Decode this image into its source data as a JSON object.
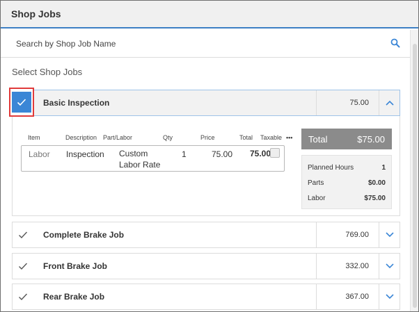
{
  "window": {
    "title": "Shop Jobs"
  },
  "search": {
    "placeholder": "Search by Shop Job Name"
  },
  "section_label": "Select Shop Jobs",
  "jobs": [
    {
      "name": "Basic Inspection",
      "price": "75.00",
      "selected": true,
      "expanded": true
    },
    {
      "name": "Complete Brake Job",
      "price": "769.00",
      "selected": false,
      "expanded": false
    },
    {
      "name": "Front Brake Job",
      "price": "332.00",
      "selected": false,
      "expanded": false
    },
    {
      "name": "Rear Brake Job",
      "price": "367.00",
      "selected": false,
      "expanded": false
    }
  ],
  "detail": {
    "columns": {
      "item": "Item",
      "description": "Description",
      "part_labor": "Part/Labor",
      "qty": "Qty",
      "price": "Price",
      "total": "Total",
      "taxable": "Taxable",
      "more": "•••"
    },
    "line": {
      "item": "Labor",
      "description": "Inspection",
      "part_labor_1": "Custom",
      "part_labor_2": "Labor Rate",
      "qty": "1",
      "price": "75.00",
      "total": "75.00"
    },
    "total_label": "Total",
    "total_amount": "$75.00",
    "summary": [
      {
        "label": "Planned Hours",
        "value": "1"
      },
      {
        "label": "Parts",
        "value": "$0.00"
      },
      {
        "label": "Labor",
        "value": "$75.00"
      }
    ]
  },
  "colors": {
    "accent": "#3b86d6",
    "highlight_border": "#e03a3a",
    "total_bar": "#8b8b8b"
  }
}
